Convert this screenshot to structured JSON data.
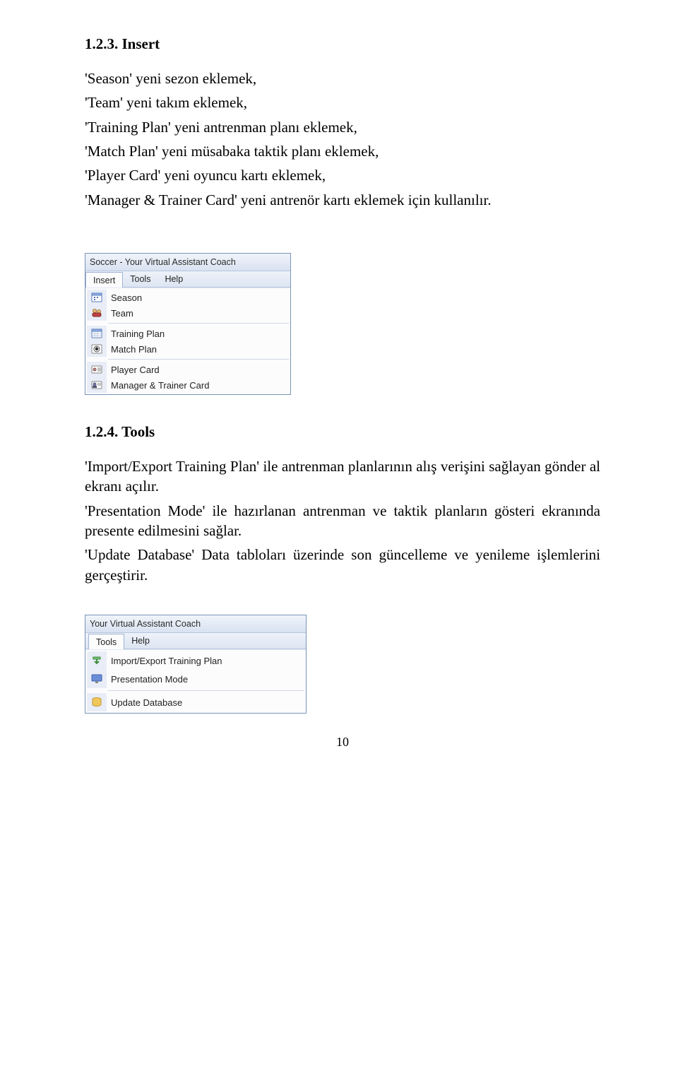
{
  "heading1": "1.2.3. Insert",
  "insert_lines": [
    "'Season' yeni sezon eklemek,",
    "'Team' yeni takım eklemek,",
    "'Training Plan' yeni antrenman planı eklemek,",
    "'Match Plan' yeni müsabaka taktik planı eklemek,",
    "'Player Card' yeni oyuncu kartı eklemek,",
    "'Manager & Trainer Card' yeni antrenör kartı eklemek için kullanılır."
  ],
  "shot1": {
    "title": "Soccer - Your Virtual Assistant Coach",
    "menus": [
      "Insert",
      "Tools",
      "Help"
    ],
    "active_menu_index": 0,
    "groups": [
      [
        "Season",
        "Team"
      ],
      [
        "Training Plan",
        "Match Plan"
      ],
      [
        "Player Card",
        "Manager & Trainer Card"
      ]
    ]
  },
  "heading2": "1.2.4. Tools",
  "tools_paras": [
    "'Import/Export Training Plan' ile antrenman planlarının alış verişini sağlayan gönder al ekranı açılır.",
    "'Presentation Mode' ile hazırlanan antrenman ve taktik planların gösteri ekranında presente edilmesini sağlar.",
    "'Update Database' Data tabloları üzerinde son güncelleme ve yenileme işlemlerini gerçeştirir."
  ],
  "shot2": {
    "title": "Your Virtual Assistant Coach",
    "menus": [
      "Tools",
      "Help"
    ],
    "active_menu_index": 0,
    "items": [
      "Import/Export Training Plan",
      "Presentation Mode",
      "Update Database"
    ]
  },
  "page_number": "10"
}
